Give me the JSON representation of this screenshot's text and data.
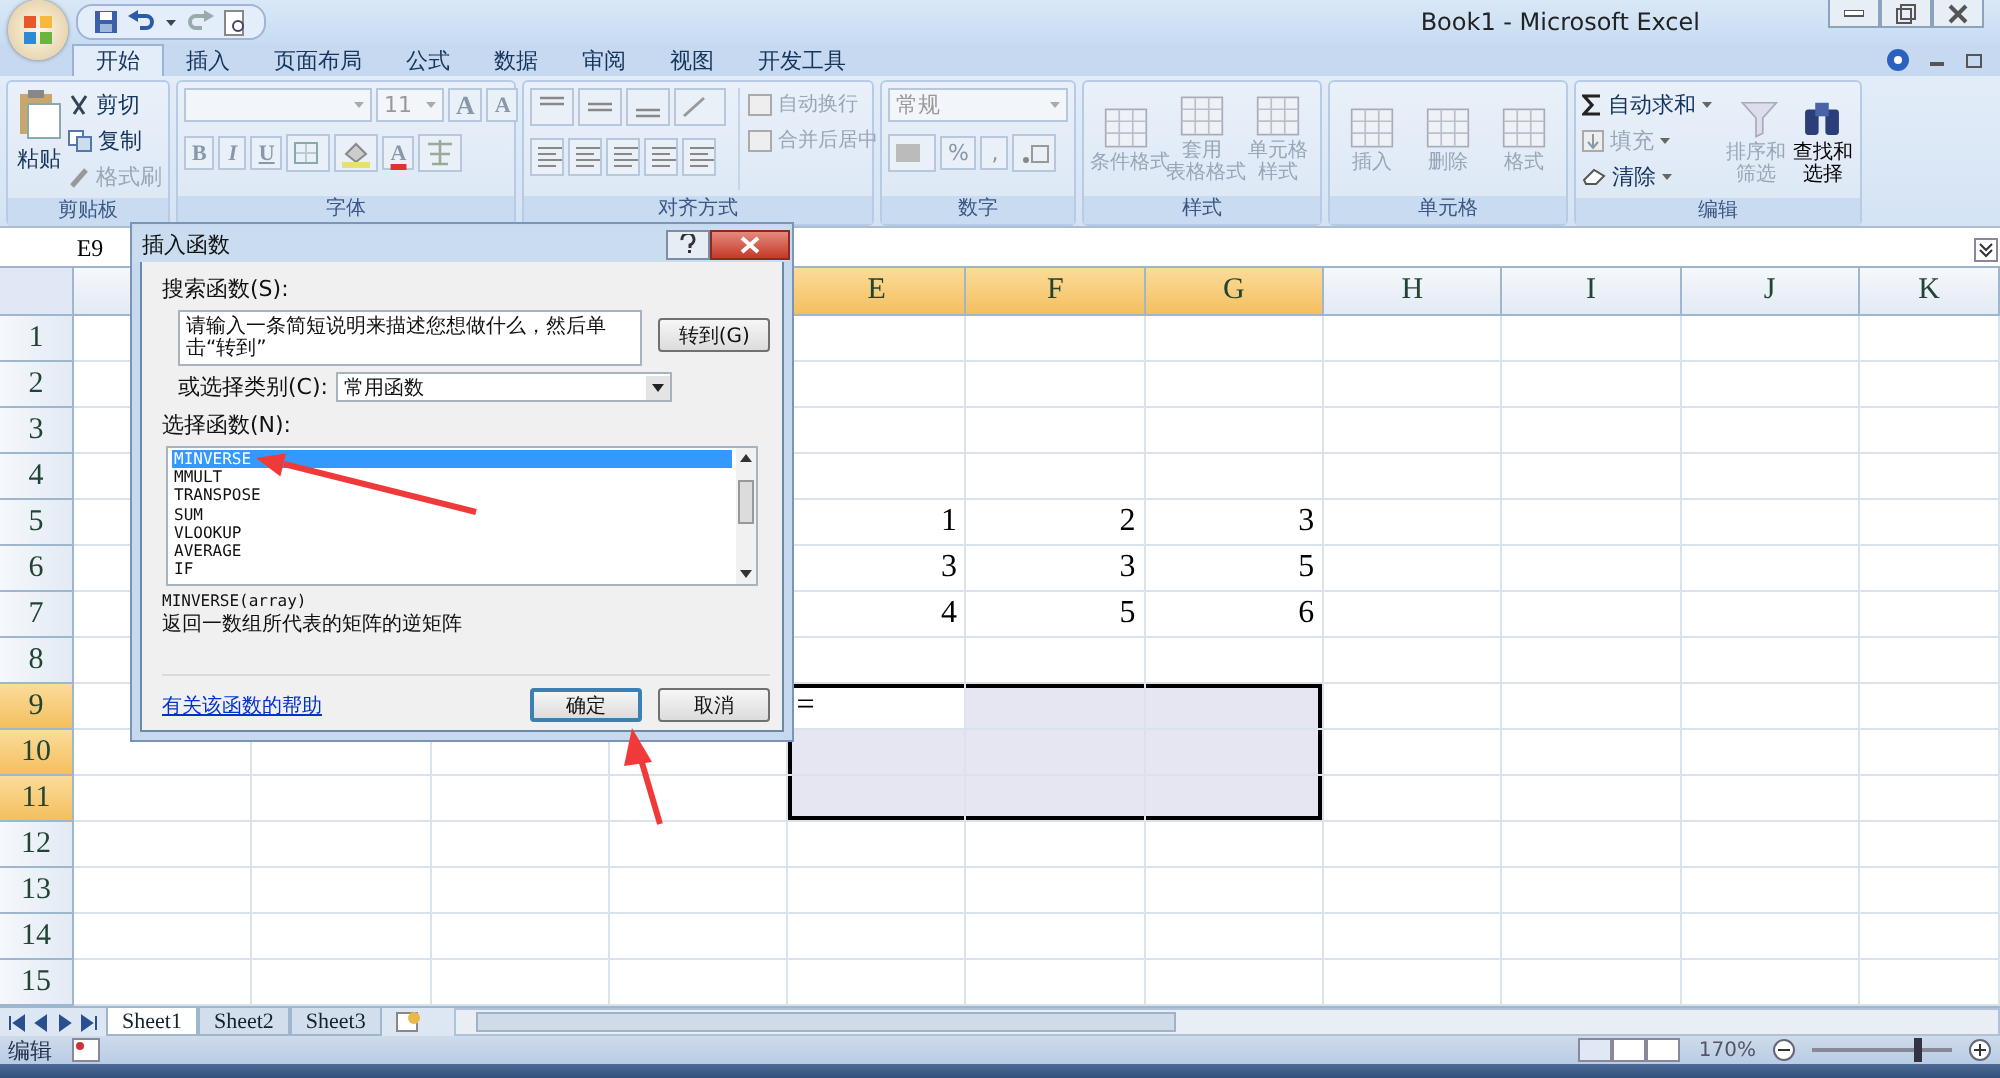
{
  "window": {
    "title": "Book1 - Microsoft Excel"
  },
  "ribbon_tabs": [
    {
      "label": "开始",
      "selected": true
    },
    {
      "label": "插入",
      "selected": false
    },
    {
      "label": "页面布局",
      "selected": false
    },
    {
      "label": "公式",
      "selected": false
    },
    {
      "label": "数据",
      "selected": false
    },
    {
      "label": "审阅",
      "selected": false
    },
    {
      "label": "视图",
      "selected": false
    },
    {
      "label": "开发工具",
      "selected": false
    }
  ],
  "ribbon_groups": [
    {
      "kind": "clipboard",
      "title": "剪贴板",
      "items": [
        {
          "label": "粘贴",
          "disabled": false
        },
        {
          "label": "剪切",
          "disabled": false
        },
        {
          "label": "复制",
          "disabled": false
        },
        {
          "label": "格式刷",
          "disabled": true
        }
      ]
    },
    {
      "kind": "font",
      "title": "字体",
      "font_size": "11",
      "size_buttons": [
        "A",
        "A"
      ],
      "style_buttons": [
        "B",
        "I",
        "U"
      ],
      "color_letter": "A"
    },
    {
      "kind": "alignment",
      "title": "对齐方式",
      "items": [
        {
          "label": "自动换行",
          "disabled": true
        },
        {
          "label": "合并后居中",
          "disabled": true
        }
      ]
    },
    {
      "kind": "number",
      "title": "数字",
      "format": "常规",
      "symbols": [
        "%",
        ","
      ]
    },
    {
      "kind": "large",
      "title": "样式",
      "items": [
        {
          "lines": [
            "条件格式"
          ],
          "disabled": true
        },
        {
          "lines": [
            "套用",
            "表格格式"
          ],
          "disabled": true
        },
        {
          "lines": [
            "单元格",
            "样式"
          ],
          "disabled": true
        }
      ]
    },
    {
      "kind": "large",
      "title": "单元格",
      "items": [
        {
          "lines": [
            "插入"
          ],
          "disabled": true
        },
        {
          "lines": [
            "删除"
          ],
          "disabled": true
        },
        {
          "lines": [
            "格式"
          ],
          "disabled": true
        }
      ]
    },
    {
      "kind": "editing",
      "title": "编辑",
      "items": [
        {
          "lines": [
            "自动求和"
          ],
          "disabled": false
        },
        {
          "lines": [
            "填充"
          ],
          "disabled": true
        },
        {
          "lines": [
            "清除"
          ],
          "disabled": false
        },
        {
          "lines": [
            "排序和",
            "筛选"
          ],
          "disabled": true
        },
        {
          "lines": [
            "查找和",
            "选择"
          ],
          "disabled": false
        }
      ]
    }
  ],
  "name_box": "E9",
  "sheet": {
    "columns": [
      {
        "label": "E",
        "selected": true
      },
      {
        "label": "F",
        "selected": true
      },
      {
        "label": "G",
        "selected": true
      },
      {
        "label": "H",
        "selected": false
      },
      {
        "label": "I",
        "selected": false
      },
      {
        "label": "J",
        "selected": false
      },
      {
        "label": "K",
        "selected": false
      }
    ],
    "rows": [
      {
        "number": "1",
        "selected": false,
        "cells": []
      },
      {
        "number": "2",
        "selected": false,
        "cells": []
      },
      {
        "number": "3",
        "selected": false,
        "cells": []
      },
      {
        "number": "4",
        "selected": false,
        "cells": []
      },
      {
        "number": "5",
        "selected": false,
        "cells": [
          {
            "value": "1",
            "kind": "number"
          },
          {
            "value": "2",
            "kind": "number"
          },
          {
            "value": "3",
            "kind": "number"
          }
        ]
      },
      {
        "number": "6",
        "selected": false,
        "cells": [
          {
            "value": "3",
            "kind": "number"
          },
          {
            "value": "3",
            "kind": "number"
          },
          {
            "value": "5",
            "kind": "number"
          }
        ]
      },
      {
        "number": "7",
        "selected": false,
        "cells": [
          {
            "value": "4",
            "kind": "number"
          },
          {
            "value": "5",
            "kind": "number"
          },
          {
            "value": "6",
            "kind": "number"
          }
        ]
      },
      {
        "number": "8",
        "selected": false,
        "cells": []
      },
      {
        "number": "9",
        "selected": true,
        "cells": [
          {
            "value": "=",
            "kind": "text"
          }
        ]
      },
      {
        "number": "10",
        "selected": true,
        "cells": []
      },
      {
        "number": "11",
        "selected": true,
        "cells": []
      },
      {
        "number": "12",
        "selected": false,
        "cells": []
      },
      {
        "number": "13",
        "selected": false,
        "cells": []
      },
      {
        "number": "14",
        "selected": false,
        "cells": []
      },
      {
        "number": "15",
        "selected": false,
        "cells": []
      }
    ]
  },
  "sheet_tabs": [
    {
      "label": "Sheet1",
      "selected": true
    },
    {
      "label": "Sheet2",
      "selected": false
    },
    {
      "label": "Sheet3",
      "selected": false
    }
  ],
  "status_bar": {
    "mode": "编辑",
    "zoom": "170%",
    "zoom_slider": {
      "level": 0.75
    }
  },
  "dialog": {
    "title": "插入函数",
    "search_label": "搜索函数(S):",
    "search_value": "请输入一条简短说明来描述您想做什么，然后单击“转到”",
    "go_button": "转到(G)",
    "category_label": "或选择类别(C):",
    "category_value": "常用函数",
    "list_label": "选择函数(N):",
    "functions": [
      {
        "label": "MINVERSE",
        "selected": true
      },
      {
        "label": "MMULT",
        "selected": false
      },
      {
        "label": "TRANSPOSE",
        "selected": false
      },
      {
        "label": "SUM",
        "selected": false
      },
      {
        "label": "VLOOKUP",
        "selected": false
      },
      {
        "label": "AVERAGE",
        "selected": false
      },
      {
        "label": "IF",
        "selected": false
      }
    ],
    "signature": "MINVERSE(array)",
    "description": "返回一数组所代表的矩阵的逆矩阵",
    "help_link": "有关该函数的帮助",
    "ok_button": "确定",
    "cancel_button": "取消"
  }
}
